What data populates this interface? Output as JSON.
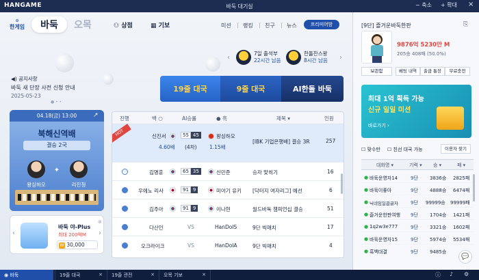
{
  "titlebar": {
    "logo": "HANGAME",
    "title": "바둑 대기실",
    "minimize": "축소",
    "maximize": "확대"
  },
  "nav": {
    "brand": "한게임",
    "tab_baduk": "바둑",
    "tab_omok": "오목",
    "shop": "상점",
    "gibo": "기보",
    "menu": [
      "미션",
      "랭킹",
      "친구",
      "뉴스"
    ],
    "premium": "프리미어방"
  },
  "notice": {
    "label": "공지사항",
    "text": "바둑 새 단장 사전 신청 안내",
    "date": "2025-05-23"
  },
  "attendance": [
    {
      "title": "7일 출석부",
      "remain": "22시간 남음"
    },
    {
      "title": "한돌찬스왕",
      "remain": "8시간 남음"
    }
  ],
  "play_buttons": [
    "19줄 대국",
    "9줄 대국",
    "AI한돌 바둑"
  ],
  "event_card": {
    "date": "04.18(금) 13:00",
    "title": "북해신역배",
    "round": "결승 2국",
    "player1": "왕싱하오",
    "player2": "리진청"
  },
  "promo": {
    "title": "바둑 야-Plus",
    "sub": "최대 200억M",
    "price": "30,000",
    "coin": "W"
  },
  "table": {
    "headers": [
      "진행",
      "백",
      "AI승률",
      "흑",
      "제목",
      "인원"
    ],
    "hot": "HOT",
    "rows": [
      {
        "white": "신진서",
        "white_rank": "4.60배",
        "score_w": "55",
        "score_b": "45",
        "note": "(4차)",
        "black": "왕싱하오",
        "black_rank": "1.15배",
        "title": "[IBK 기업은행배] 결승 3R",
        "count": "257"
      },
      {
        "white": "김명훈",
        "white_rank": "",
        "score_w": "65",
        "score_b": "35",
        "note": "",
        "black": "신민준",
        "black_rank": "",
        "title": "승자 맞히기",
        "count": "16"
      },
      {
        "white": "우에노 리사",
        "white_rank": "",
        "score_w": "91",
        "score_b": "9",
        "note": "",
        "black": "미야기 유키",
        "black_rank": "",
        "title": "[닥터지 여자리그] 예선",
        "count": "6"
      },
      {
        "white": "김주아",
        "white_rank": "",
        "score_w": "91",
        "score_b": "9",
        "note": "",
        "black": "이나현",
        "black_rank": "",
        "title": "월드바둑 챔피언십 결승",
        "count": "51"
      },
      {
        "white": "다산인",
        "white_rank": "",
        "score_w": "",
        "score_b": "",
        "note": "VS",
        "black": "HanDolS",
        "black_rank": "",
        "title": "9단 빅매치",
        "count": "17"
      },
      {
        "white": "오크라이크",
        "white_rank": "",
        "score_w": "",
        "score_b": "",
        "note": "VS",
        "black": "HanDolA",
        "black_rank": "",
        "title": "9단 빅매치",
        "count": "4"
      }
    ]
  },
  "profile": {
    "header": "[9단] 즐거운바둑한판",
    "points": "9876억 5230만 M",
    "record": "205승 408패 (50.0%)",
    "buttons": [
      "보관함",
      "베팅 내역",
      "출금 통장",
      "무료충전"
    ]
  },
  "banner": {
    "title": "최대 1억 획득 가능",
    "sub": "신규 일일 미션",
    "go": "바로가기"
  },
  "filters": {
    "wait": "맞수만",
    "friend": "친선 대국 가능",
    "find": "이용자 찾기"
  },
  "userlist": {
    "headers": [
      "대화명",
      "기력",
      "승",
      "패"
    ],
    "rows": [
      {
        "name": "바둑운영자14",
        "rank": "9단",
        "win": "3836승",
        "loss": "2825패"
      },
      {
        "name": "바둑이좋아",
        "rank": "9단",
        "win": "4888승",
        "loss": "6474패"
      },
      {
        "name": "닉네임일곱글자",
        "rank": "9단",
        "win": "99999승",
        "loss": "99999패"
      },
      {
        "name": "즐거운한판여행",
        "rank": "9단",
        "win": "1704승",
        "loss": "1421패"
      },
      {
        "name": "1q2w3e777",
        "rank": "9단",
        "win": "3321승",
        "loss": "1602패"
      },
      {
        "name": "바둑운영자15",
        "rank": "9단",
        "win": "5974승",
        "loss": "5534패"
      },
      {
        "name": "흑백대결",
        "rank": "9단",
        "win": "9485승",
        "loss": "3154패"
      }
    ]
  },
  "taskbar": {
    "tabs": [
      "바둑",
      "19줄 대국",
      "19줄 관전",
      "오목 기보"
    ]
  },
  "colors": {
    "accent": "#1f4fa8",
    "play19": "#2b6fd6",
    "play9": "#1f4fa8",
    "ai": "#1b3f8a",
    "hot": "#e0463f"
  }
}
